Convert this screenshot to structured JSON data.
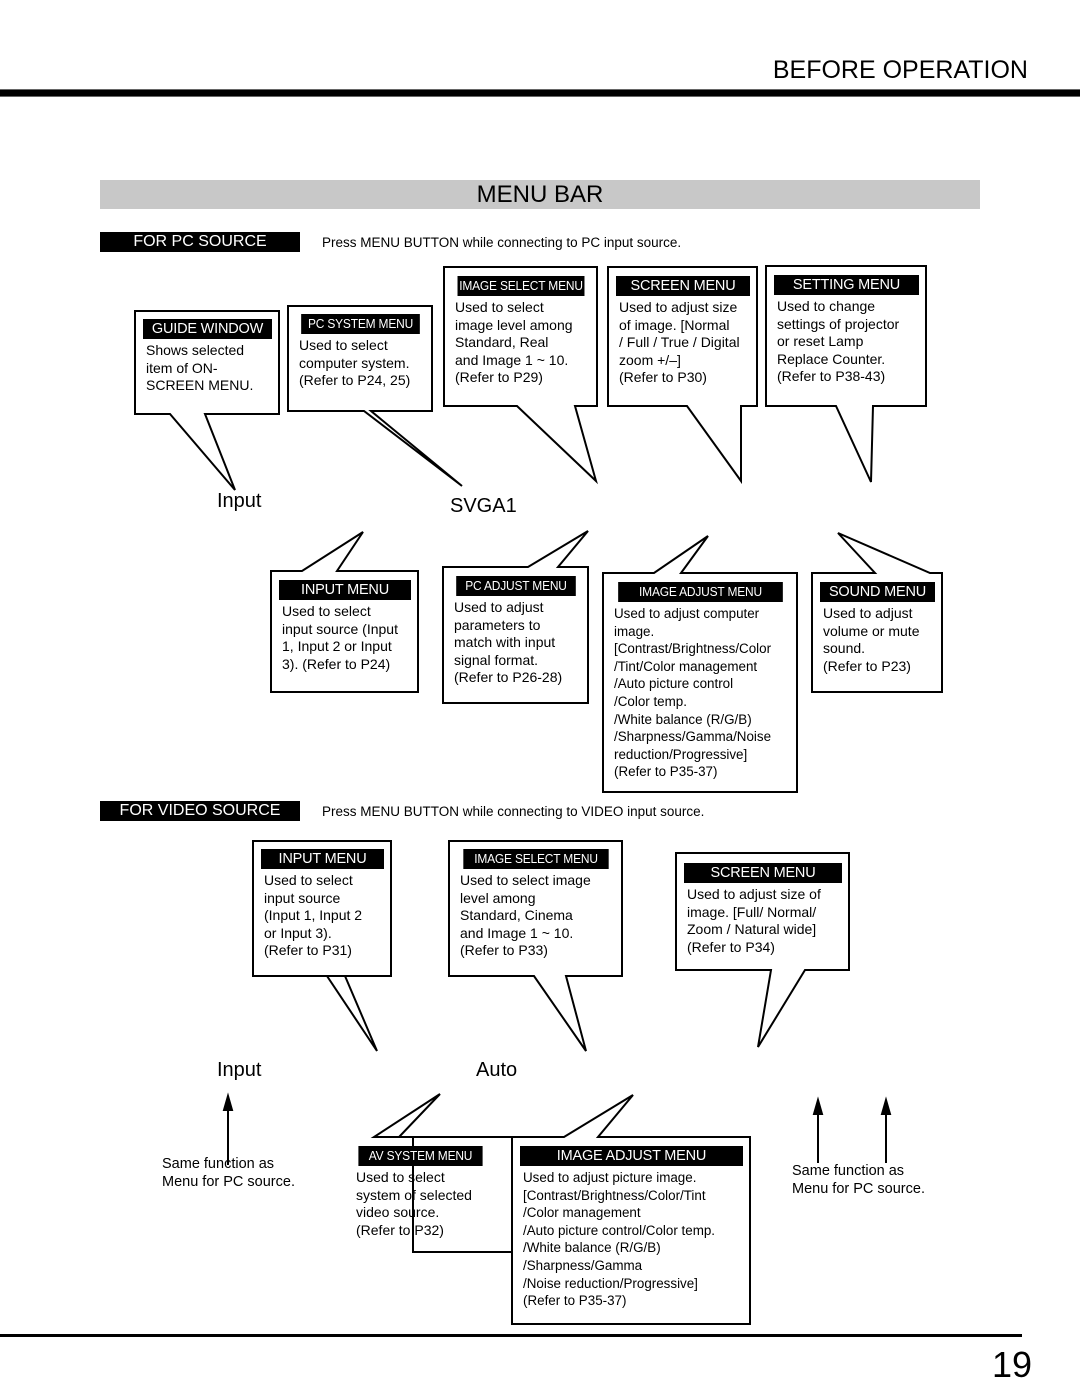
{
  "header": {
    "section": "BEFORE OPERATION",
    "title": "MENU BAR"
  },
  "pc_source": {
    "label": "FOR PC SOURCE",
    "instruction": "Press MENU BUTTON while connecting to PC input source.",
    "menubar_items": {
      "left": "Input",
      "right": "SVGA1"
    },
    "top_callouts": [
      {
        "title": "GUIDE WINDOW",
        "body": "Shows selected\nitem of ON-\nSCREEN MENU."
      },
      {
        "title": "PC SYSTEM MENU",
        "body": "Used to select\ncomputer system.\n(Refer to P24, 25)"
      },
      {
        "title": "IMAGE SELECT MENU",
        "body": "Used to select\nimage level among\nStandard, Real\nand Image 1 ~ 10.\n(Refer to P29)"
      },
      {
        "title": "SCREEN MENU",
        "body": "Used to adjust size\nof image.  [Normal\n/ Full / True / Digital\nzoom +/–]\n(Refer to P30)"
      },
      {
        "title": "SETTING MENU",
        "body": "Used to change\nsettings of projector\nor reset Lamp\nReplace Counter.\n(Refer to P38-43)"
      }
    ],
    "bottom_callouts": [
      {
        "title": "INPUT MENU",
        "body": "Used to select\ninput source (Input\n1, Input 2 or Input\n3). (Refer to P24)"
      },
      {
        "title": "PC ADJUST MENU",
        "body": "Used to adjust\nparameters to\nmatch with input\nsignal format.\n(Refer to P26-28)"
      },
      {
        "title": "IMAGE ADJUST MENU",
        "body": "Used to adjust computer\nimage.\n[Contrast/Brightness/Color\n/Tint/Color management\n/Auto picture control\n/Color temp.\n/White balance (R/G/B)\n/Sharpness/Gamma/Noise\nreduction/Progressive]\n(Refer to P35-37)"
      },
      {
        "title": "SOUND MENU",
        "body": "Used to adjust\nvolume or mute\nsound.\n(Refer to P23)"
      }
    ]
  },
  "video_source": {
    "label": "FOR VIDEO SOURCE",
    "instruction": "Press MENU BUTTON while connecting to VIDEO input source.",
    "menubar_items": {
      "left": "Input",
      "right": "Auto"
    },
    "top_callouts": [
      {
        "title": "INPUT MENU",
        "body": "Used to select\ninput source\n(Input 1, Input 2\nor Input 3).\n(Refer to P31)"
      },
      {
        "title": "IMAGE SELECT MENU",
        "body": "Used to select image\nlevel among\nStandard, Cinema\nand Image 1 ~ 10.\n(Refer to P33)"
      },
      {
        "title": "SCREEN MENU",
        "body": "Used to adjust size of\nimage.  [Full/ Normal/\nZoom / Natural wide]\n (Refer to P34)"
      }
    ],
    "bottom_callouts": [
      {
        "title": "AV SYSTEM MENU",
        "body": "Used to select\nsystem of selected\nvideo source.\n(Refer to P32)"
      },
      {
        "title": "IMAGE ADJUST MENU",
        "body": "Used to adjust picture image.\n[Contrast/Brightness/Color/Tint\n/Color management\n/Auto picture control/Color temp.\n/White balance (R/G/B)\n/Sharpness/Gamma\n/Noise reduction/Progressive]\n(Refer to P35-37)"
      }
    ],
    "notes": {
      "left": "Same function as\nMenu for PC source.",
      "right": "Same function as\nMenu for PC source."
    }
  },
  "footer": {
    "page_number": "19"
  }
}
